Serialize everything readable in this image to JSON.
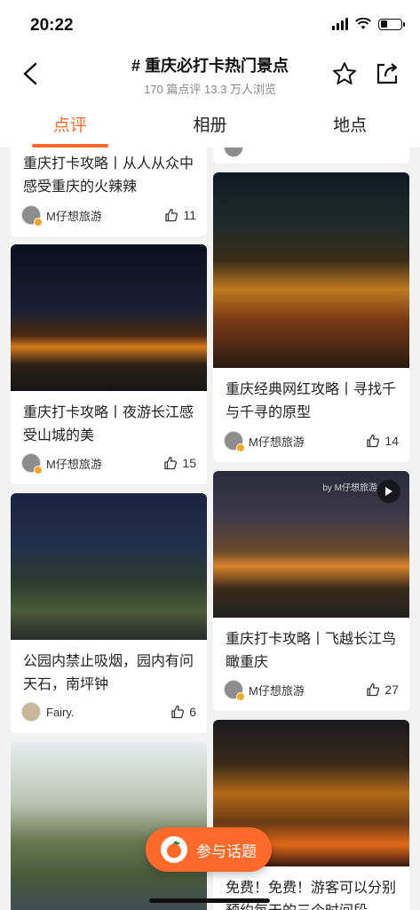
{
  "status_bar": {
    "time": "20:22"
  },
  "nav": {
    "title": "# 重庆必打卡热门景点",
    "subtitle": "170 篇点评 13.3 万人浏览",
    "back_icon": "chevron-left-icon",
    "favorite_icon": "star-icon",
    "share_icon": "share-icon"
  },
  "tabs": [
    {
      "label": "点评",
      "active": true
    },
    {
      "label": "相册",
      "active": false
    },
    {
      "label": "地点",
      "active": false
    }
  ],
  "left_cards": [
    {
      "title": "重庆打卡攻略丨从人从众中感受重庆的火辣辣",
      "author": "M仔想旅游",
      "likes": "11"
    },
    {
      "title": "重庆打卡攻略丨夜游长江感受山城的美",
      "author": "M仔想旅游",
      "likes": "15"
    },
    {
      "title": "公园内禁止吸烟，园内有问天石，南坪钟",
      "author": "Fairy.",
      "likes": "6"
    },
    {
      "title": ""
    }
  ],
  "right_cards": [
    {
      "title": ""
    },
    {
      "title": "重庆经典网红攻略丨寻找千与千寻的原型",
      "author": "M仔想旅游",
      "likes": "14"
    },
    {
      "title": "重庆打卡攻略丨飞越长江鸟瞰重庆",
      "author": "M仔想旅游",
      "likes": "27",
      "watermark": "by M仔想旅游"
    },
    {
      "title": "免费！免费！游客可以分别预约每天的三个时间段"
    }
  ],
  "fab": {
    "label": "参与话题"
  },
  "colors": {
    "accent": "#ff6a2a"
  }
}
